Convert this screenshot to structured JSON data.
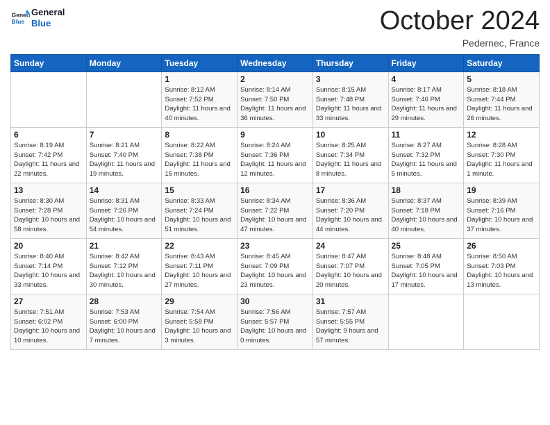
{
  "logo": {
    "line1": "General",
    "line2": "Blue"
  },
  "title": "October 2024",
  "subtitle": "Pedernec, France",
  "header_days": [
    "Sunday",
    "Monday",
    "Tuesday",
    "Wednesday",
    "Thursday",
    "Friday",
    "Saturday"
  ],
  "weeks": [
    [
      {
        "day": "",
        "sunrise": "",
        "sunset": "",
        "daylight": ""
      },
      {
        "day": "",
        "sunrise": "",
        "sunset": "",
        "daylight": ""
      },
      {
        "day": "1",
        "sunrise": "Sunrise: 8:12 AM",
        "sunset": "Sunset: 7:52 PM",
        "daylight": "Daylight: 11 hours and 40 minutes."
      },
      {
        "day": "2",
        "sunrise": "Sunrise: 8:14 AM",
        "sunset": "Sunset: 7:50 PM",
        "daylight": "Daylight: 11 hours and 36 minutes."
      },
      {
        "day": "3",
        "sunrise": "Sunrise: 8:15 AM",
        "sunset": "Sunset: 7:48 PM",
        "daylight": "Daylight: 11 hours and 33 minutes."
      },
      {
        "day": "4",
        "sunrise": "Sunrise: 8:17 AM",
        "sunset": "Sunset: 7:46 PM",
        "daylight": "Daylight: 11 hours and 29 minutes."
      },
      {
        "day": "5",
        "sunrise": "Sunrise: 8:18 AM",
        "sunset": "Sunset: 7:44 PM",
        "daylight": "Daylight: 11 hours and 26 minutes."
      }
    ],
    [
      {
        "day": "6",
        "sunrise": "Sunrise: 8:19 AM",
        "sunset": "Sunset: 7:42 PM",
        "daylight": "Daylight: 11 hours and 22 minutes."
      },
      {
        "day": "7",
        "sunrise": "Sunrise: 8:21 AM",
        "sunset": "Sunset: 7:40 PM",
        "daylight": "Daylight: 11 hours and 19 minutes."
      },
      {
        "day": "8",
        "sunrise": "Sunrise: 8:22 AM",
        "sunset": "Sunset: 7:38 PM",
        "daylight": "Daylight: 11 hours and 15 minutes."
      },
      {
        "day": "9",
        "sunrise": "Sunrise: 8:24 AM",
        "sunset": "Sunset: 7:36 PM",
        "daylight": "Daylight: 11 hours and 12 minutes."
      },
      {
        "day": "10",
        "sunrise": "Sunrise: 8:25 AM",
        "sunset": "Sunset: 7:34 PM",
        "daylight": "Daylight: 11 hours and 8 minutes."
      },
      {
        "day": "11",
        "sunrise": "Sunrise: 8:27 AM",
        "sunset": "Sunset: 7:32 PM",
        "daylight": "Daylight: 11 hours and 5 minutes."
      },
      {
        "day": "12",
        "sunrise": "Sunrise: 8:28 AM",
        "sunset": "Sunset: 7:30 PM",
        "daylight": "Daylight: 11 hours and 1 minute."
      }
    ],
    [
      {
        "day": "13",
        "sunrise": "Sunrise: 8:30 AM",
        "sunset": "Sunset: 7:28 PM",
        "daylight": "Daylight: 10 hours and 58 minutes."
      },
      {
        "day": "14",
        "sunrise": "Sunrise: 8:31 AM",
        "sunset": "Sunset: 7:26 PM",
        "daylight": "Daylight: 10 hours and 54 minutes."
      },
      {
        "day": "15",
        "sunrise": "Sunrise: 8:33 AM",
        "sunset": "Sunset: 7:24 PM",
        "daylight": "Daylight: 10 hours and 51 minutes."
      },
      {
        "day": "16",
        "sunrise": "Sunrise: 8:34 AM",
        "sunset": "Sunset: 7:22 PM",
        "daylight": "Daylight: 10 hours and 47 minutes."
      },
      {
        "day": "17",
        "sunrise": "Sunrise: 8:36 AM",
        "sunset": "Sunset: 7:20 PM",
        "daylight": "Daylight: 10 hours and 44 minutes."
      },
      {
        "day": "18",
        "sunrise": "Sunrise: 8:37 AM",
        "sunset": "Sunset: 7:18 PM",
        "daylight": "Daylight: 10 hours and 40 minutes."
      },
      {
        "day": "19",
        "sunrise": "Sunrise: 8:39 AM",
        "sunset": "Sunset: 7:16 PM",
        "daylight": "Daylight: 10 hours and 37 minutes."
      }
    ],
    [
      {
        "day": "20",
        "sunrise": "Sunrise: 8:40 AM",
        "sunset": "Sunset: 7:14 PM",
        "daylight": "Daylight: 10 hours and 33 minutes."
      },
      {
        "day": "21",
        "sunrise": "Sunrise: 8:42 AM",
        "sunset": "Sunset: 7:12 PM",
        "daylight": "Daylight: 10 hours and 30 minutes."
      },
      {
        "day": "22",
        "sunrise": "Sunrise: 8:43 AM",
        "sunset": "Sunset: 7:11 PM",
        "daylight": "Daylight: 10 hours and 27 minutes."
      },
      {
        "day": "23",
        "sunrise": "Sunrise: 8:45 AM",
        "sunset": "Sunset: 7:09 PM",
        "daylight": "Daylight: 10 hours and 23 minutes."
      },
      {
        "day": "24",
        "sunrise": "Sunrise: 8:47 AM",
        "sunset": "Sunset: 7:07 PM",
        "daylight": "Daylight: 10 hours and 20 minutes."
      },
      {
        "day": "25",
        "sunrise": "Sunrise: 8:48 AM",
        "sunset": "Sunset: 7:05 PM",
        "daylight": "Daylight: 10 hours and 17 minutes."
      },
      {
        "day": "26",
        "sunrise": "Sunrise: 8:50 AM",
        "sunset": "Sunset: 7:03 PM",
        "daylight": "Daylight: 10 hours and 13 minutes."
      }
    ],
    [
      {
        "day": "27",
        "sunrise": "Sunrise: 7:51 AM",
        "sunset": "Sunset: 6:02 PM",
        "daylight": "Daylight: 10 hours and 10 minutes."
      },
      {
        "day": "28",
        "sunrise": "Sunrise: 7:53 AM",
        "sunset": "Sunset: 6:00 PM",
        "daylight": "Daylight: 10 hours and 7 minutes."
      },
      {
        "day": "29",
        "sunrise": "Sunrise: 7:54 AM",
        "sunset": "Sunset: 5:58 PM",
        "daylight": "Daylight: 10 hours and 3 minutes."
      },
      {
        "day": "30",
        "sunrise": "Sunrise: 7:56 AM",
        "sunset": "Sunset: 5:57 PM",
        "daylight": "Daylight: 10 hours and 0 minutes."
      },
      {
        "day": "31",
        "sunrise": "Sunrise: 7:57 AM",
        "sunset": "Sunset: 5:55 PM",
        "daylight": "Daylight: 9 hours and 57 minutes."
      },
      {
        "day": "",
        "sunrise": "",
        "sunset": "",
        "daylight": ""
      },
      {
        "day": "",
        "sunrise": "",
        "sunset": "",
        "daylight": ""
      }
    ]
  ]
}
